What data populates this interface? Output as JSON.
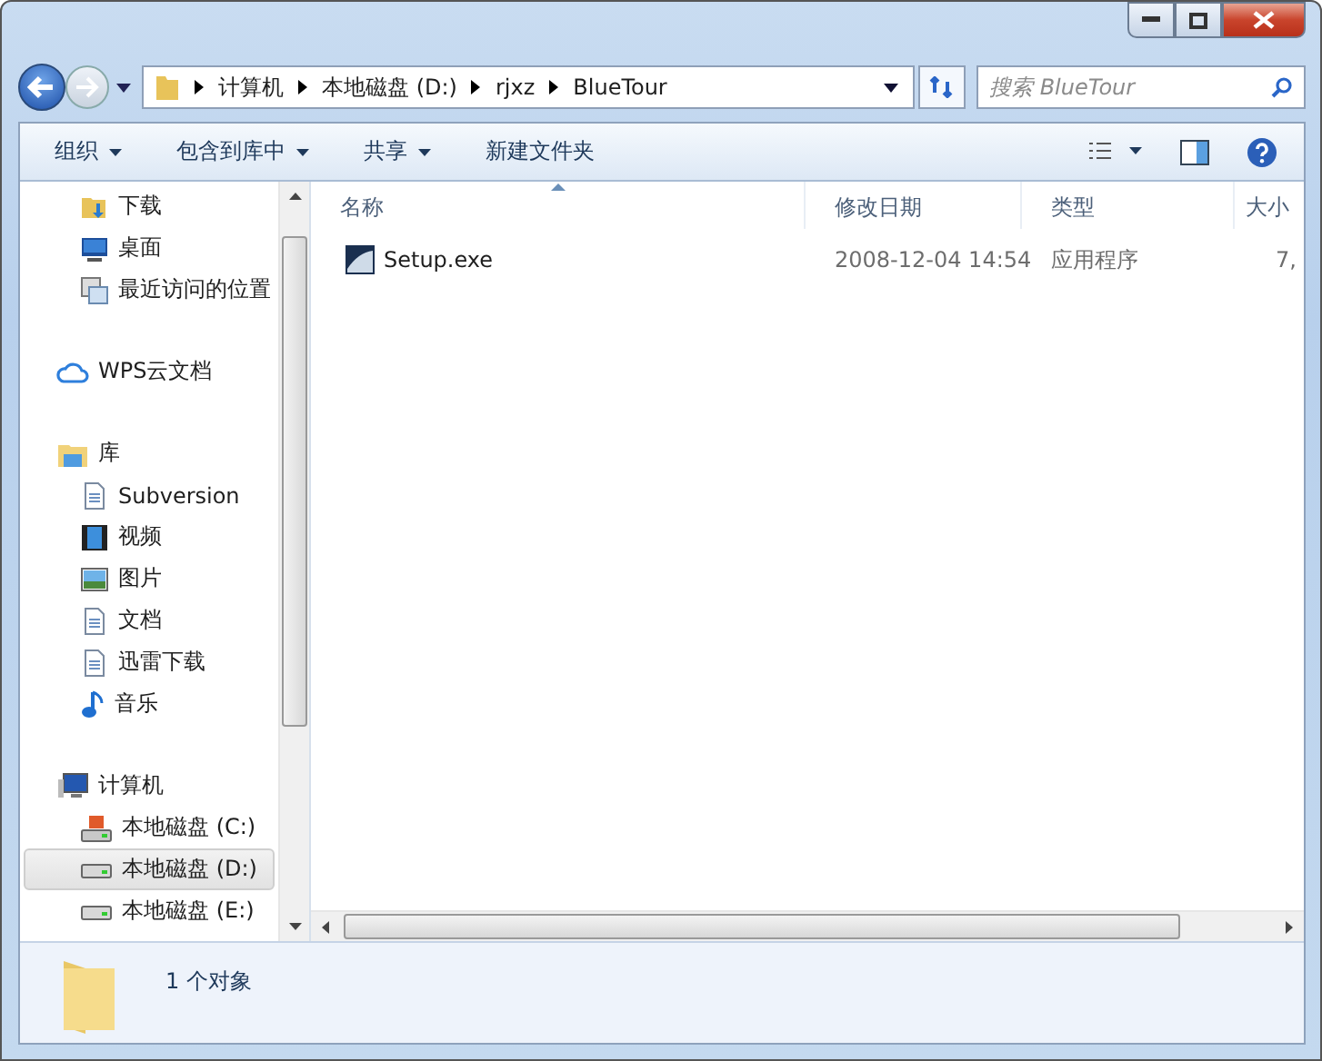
{
  "address": {
    "crumbs": [
      "计算机",
      "本地磁盘 (D:)",
      "rjxz",
      "BlueTour"
    ]
  },
  "search": {
    "placeholder": "搜索 BlueTour"
  },
  "toolbar": [
    {
      "label": "组织",
      "dropdown": true
    },
    {
      "label": "包含到库中",
      "dropdown": true
    },
    {
      "label": "共享",
      "dropdown": true
    },
    {
      "label": "新建文件夹",
      "dropdown": false
    }
  ],
  "sidebar": [
    {
      "children": [
        {
          "kind": "download",
          "label": "下载",
          "selected": false
        },
        {
          "kind": "desktop",
          "label": "桌面",
          "selected": false
        },
        {
          "kind": "recent",
          "label": "最近访问的位置",
          "selected": false
        }
      ]
    },
    {
      "kind": "cloud",
      "label": "WPS云文档"
    },
    {
      "kind": "library",
      "label": "库",
      "children": [
        {
          "kind": "document",
          "label": "Subversion",
          "selected": false
        },
        {
          "kind": "video",
          "label": "视频",
          "selected": false
        },
        {
          "kind": "picture",
          "label": "图片",
          "selected": false
        },
        {
          "kind": "document",
          "label": "文档",
          "selected": false
        },
        {
          "kind": "document",
          "label": "迅雷下载",
          "selected": false
        },
        {
          "kind": "music",
          "label": "音乐",
          "selected": false
        }
      ]
    },
    {
      "kind": "computer",
      "label": "计算机",
      "children": [
        {
          "kind": "drive-system",
          "label": "本地磁盘 (C:)",
          "selected": false
        },
        {
          "kind": "drive",
          "label": "本地磁盘 (D:)",
          "selected": true
        },
        {
          "kind": "drive",
          "label": "本地磁盘 (E:)",
          "selected": false
        }
      ]
    }
  ],
  "table": {
    "columns": [
      {
        "label": "名称",
        "sorted": true
      },
      {
        "label": "修改日期",
        "sorted": false
      },
      {
        "label": "类型",
        "sorted": false
      },
      {
        "label": "大小",
        "sorted": false
      }
    ],
    "rows": [
      {
        "cells": [
          "Setup.exe",
          "2008-12-04 14:54",
          "应用程序",
          "7,"
        ]
      }
    ]
  },
  "status_bar": {
    "text": "1 个对象"
  }
}
